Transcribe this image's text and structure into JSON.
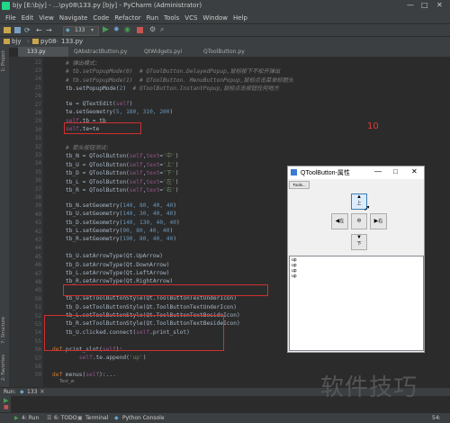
{
  "window": {
    "title": "bjy [E:\\bjy] - ...\\py08\\133.py [bjy] - PyCharm (Administrator)"
  },
  "menu": [
    "File",
    "Edit",
    "View",
    "Navigate",
    "Code",
    "Refactor",
    "Run",
    "Tools",
    "VCS",
    "Window",
    "Help"
  ],
  "run_config": "133",
  "breadcrumb": [
    "bjy",
    "py08",
    "133.py"
  ],
  "tabs": [
    "133.py",
    "QAbstractButton.py",
    "QtWidgets.pyi",
    "QToolButton.py"
  ],
  "side_panels": {
    "project": "1: Project",
    "structure": "7: Structure",
    "favorites": "2: Favorites"
  },
  "code_lines": [
    {
      "n": "22",
      "segs": [
        [
          "cm",
          "# 弹出模式:"
        ]
      ]
    },
    {
      "n": "23",
      "segs": [
        [
          "cm",
          "# tb.setPopupMode(0)  # QToolButton.DelayedPopup,鼠标按下不松开弹出"
        ]
      ]
    },
    {
      "n": "24",
      "segs": [
        [
          "cm",
          "# tb.setPopupMode(1)  # QToolButton. MenuButtonPopup,鼠标点击菜单标题头"
        ]
      ]
    },
    {
      "n": "25",
      "segs": [
        [
          "pl",
          "tb.setPopupMode("
        ],
        [
          "nm",
          "2"
        ],
        [
          "pl",
          ")  "
        ],
        [
          "cm",
          "# QToolButton.InstantPopup,鼠标点击按钮任何地方"
        ]
      ]
    },
    {
      "n": "26",
      "segs": [
        [
          "pl",
          ""
        ]
      ]
    },
    {
      "n": "27",
      "segs": [
        [
          "pl",
          "te = QTextEdit("
        ],
        [
          "sf",
          "self"
        ],
        [
          "pl",
          ")"
        ]
      ]
    },
    {
      "n": "28",
      "segs": [
        [
          "pl",
          "te.setGeometry("
        ],
        [
          "nm",
          "5, 180, 310, 200"
        ],
        [
          "pl",
          ")"
        ]
      ]
    },
    {
      "n": "29",
      "segs": [
        [
          "sf",
          "self"
        ],
        [
          "pl",
          ".tb = tb"
        ]
      ]
    },
    {
      "n": "30",
      "segs": [
        [
          "sf",
          "self"
        ],
        [
          "pl",
          ".te=te"
        ]
      ]
    },
    {
      "n": "31",
      "segs": [
        [
          "pl",
          ""
        ]
      ]
    },
    {
      "n": "32",
      "segs": [
        [
          "cm",
          "# 箭头按钮测试:"
        ]
      ]
    },
    {
      "n": "33",
      "segs": [
        [
          "pl",
          "tb_N = QToolButton("
        ],
        [
          "sf",
          "self"
        ],
        [
          "pl",
          ","
        ],
        [
          "sf",
          "text"
        ],
        [
          "pl",
          "="
        ],
        [
          "st",
          "'中'"
        ],
        [
          "pl",
          ")"
        ]
      ]
    },
    {
      "n": "34",
      "segs": [
        [
          "pl",
          "tb_U = QToolButton("
        ],
        [
          "sf",
          "self"
        ],
        [
          "pl",
          ","
        ],
        [
          "sf",
          "text"
        ],
        [
          "pl",
          "="
        ],
        [
          "st",
          "'上'"
        ],
        [
          "pl",
          ")"
        ]
      ]
    },
    {
      "n": "35",
      "segs": [
        [
          "pl",
          "tb_D = QToolButton("
        ],
        [
          "sf",
          "self"
        ],
        [
          "pl",
          ","
        ],
        [
          "sf",
          "text"
        ],
        [
          "pl",
          "="
        ],
        [
          "st",
          "'下'"
        ],
        [
          "pl",
          ")"
        ]
      ]
    },
    {
      "n": "36",
      "segs": [
        [
          "pl",
          "tb_L = QToolButton("
        ],
        [
          "sf",
          "self"
        ],
        [
          "pl",
          ","
        ],
        [
          "sf",
          "text"
        ],
        [
          "pl",
          "="
        ],
        [
          "st",
          "'左'"
        ],
        [
          "pl",
          ")"
        ]
      ]
    },
    {
      "n": "37",
      "segs": [
        [
          "pl",
          "tb_R = QToolButton("
        ],
        [
          "sf",
          "self"
        ],
        [
          "pl",
          ","
        ],
        [
          "sf",
          "text"
        ],
        [
          "pl",
          "="
        ],
        [
          "st",
          "'右'"
        ],
        [
          "pl",
          ")"
        ]
      ]
    },
    {
      "n": "38",
      "segs": [
        [
          "pl",
          ""
        ]
      ]
    },
    {
      "n": "39",
      "segs": [
        [
          "pl",
          "tb_N.setGeometry("
        ],
        [
          "nm",
          "140, 80, 40, 40"
        ],
        [
          "pl",
          ")"
        ]
      ]
    },
    {
      "n": "40",
      "segs": [
        [
          "pl",
          "tb_U.setGeometry("
        ],
        [
          "nm",
          "140, 30, 40, 40"
        ],
        [
          "pl",
          ")"
        ]
      ]
    },
    {
      "n": "41",
      "segs": [
        [
          "pl",
          "tb_D.setGeometry("
        ],
        [
          "nm",
          "140, 130, 40, 40"
        ],
        [
          "pl",
          ")"
        ]
      ]
    },
    {
      "n": "42",
      "segs": [
        [
          "pl",
          "tb_L.setGeometry("
        ],
        [
          "nm",
          "90, 80, 40, 40"
        ],
        [
          "pl",
          ")"
        ]
      ]
    },
    {
      "n": "43",
      "segs": [
        [
          "pl",
          "tb_R.setGeometry("
        ],
        [
          "nm",
          "190, 80, 40, 40"
        ],
        [
          "pl",
          ")"
        ]
      ]
    },
    {
      "n": "44",
      "segs": [
        [
          "pl",
          ""
        ]
      ]
    },
    {
      "n": "45",
      "segs": [
        [
          "pl",
          "tb_U.setArrowType(Qt.UpArrow)"
        ]
      ]
    },
    {
      "n": "46",
      "segs": [
        [
          "pl",
          "tb_D.setArrowType(Qt.DownArrow)"
        ]
      ]
    },
    {
      "n": "47",
      "segs": [
        [
          "pl",
          "tb_L.setArrowType(Qt.LeftArrow)"
        ]
      ]
    },
    {
      "n": "48",
      "segs": [
        [
          "pl",
          "tb_R.setArrowType(Qt.RightArrow)"
        ]
      ]
    },
    {
      "n": "49",
      "segs": [
        [
          "pl",
          ""
        ]
      ]
    },
    {
      "n": "50",
      "segs": [
        [
          "pl",
          "tb_U.setToolButtonStyle(Qt.ToolButtonTextUnderIcon)"
        ]
      ]
    },
    {
      "n": "51",
      "segs": [
        [
          "pl",
          "tb_D.setToolButtonStyle(Qt.ToolButtonTextUnderIcon)"
        ]
      ]
    },
    {
      "n": "52",
      "segs": [
        [
          "pl",
          "tb_L.setToolButtonStyle(Qt.ToolButtonTextBesideIcon)"
        ]
      ]
    },
    {
      "n": "53",
      "segs": [
        [
          "pl",
          "tb_R.setToolButtonStyle(Qt.ToolButtonTextBesideIcon)"
        ]
      ]
    },
    {
      "n": "54",
      "segs": [
        [
          "pl",
          "tb_U.clicked.connect("
        ],
        [
          "sf",
          "self"
        ],
        [
          "pl",
          ".print_slot)"
        ]
      ]
    },
    {
      "n": "55",
      "segs": [
        [
          "pl",
          ""
        ]
      ]
    },
    {
      "n": "56",
      "segs": [
        [
          "kw",
          "def "
        ],
        [
          "pl",
          "print_slot("
        ],
        [
          "sf",
          "self"
        ],
        [
          "pl",
          "):"
        ]
      ]
    },
    {
      "n": "57",
      "segs": [
        [
          "pl",
          "    "
        ],
        [
          "sf",
          "self"
        ],
        [
          "pl",
          ".te.append("
        ],
        [
          "st",
          "'up'"
        ],
        [
          "pl",
          ")"
        ]
      ]
    },
    {
      "n": "58",
      "segs": [
        [
          "pl",
          ""
        ]
      ]
    },
    {
      "n": "59",
      "segs": [
        [
          "kw",
          "def "
        ],
        [
          "pl",
          "menus("
        ],
        [
          "sf",
          "self"
        ],
        [
          "pl",
          "):..."
        ]
      ]
    }
  ],
  "annotation_number": "10",
  "footer_hint": "Test_w",
  "run_panel": {
    "label": "Run:",
    "config": "133"
  },
  "bottom_tabs": [
    "4: Run",
    "6: TODO",
    "Terminal",
    "Python Console"
  ],
  "status_right": "54:",
  "qt_window": {
    "title": "QToolButton-属性",
    "tools_label": "Tools...",
    "btn_up": "上",
    "btn_left": "左",
    "btn_center": "中",
    "btn_right": "右",
    "btn_down": "下",
    "output_lines": [
      "up",
      "up",
      "up",
      "up"
    ]
  },
  "watermark": "软件技巧",
  "colors": {
    "comment": "#808080",
    "keyword": "#cc7832",
    "self": "#94558d",
    "string": "#6a8759",
    "number": "#6897bb",
    "annotation_red": "#d0302f"
  }
}
